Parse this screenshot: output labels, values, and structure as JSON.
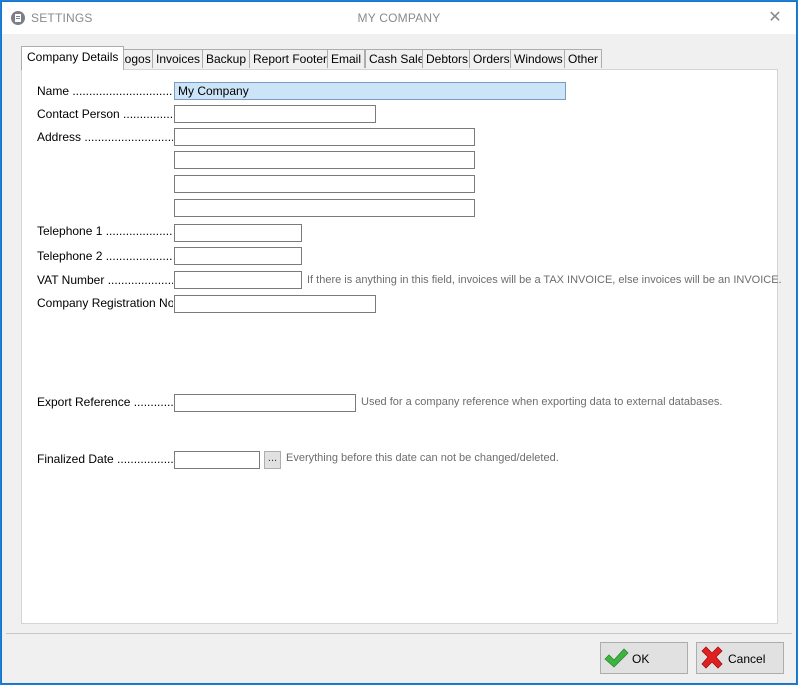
{
  "window": {
    "title_left": "SETTINGS",
    "title_center": "MY COMPANY",
    "close_glyph": "✕"
  },
  "tabs": [
    {
      "label": "Company Details",
      "active": true
    },
    {
      "label": "Logos"
    },
    {
      "label": "Invoices"
    },
    {
      "label": "Backup"
    },
    {
      "label": "Report Footers"
    },
    {
      "label": "Email"
    },
    {
      "label": "Cash Sale"
    },
    {
      "label": "Debtors"
    },
    {
      "label": "Orders"
    },
    {
      "label": "Windows"
    },
    {
      "label": "Other"
    }
  ],
  "form": {
    "name_label": "Name .......................................",
    "name_value": "My Company",
    "contact_label": "Contact Person ......................",
    "contact_value": "",
    "address_label": "Address ..................................",
    "address_lines": [
      "",
      "",
      "",
      ""
    ],
    "tel1_label": "Telephone 1 ...........................",
    "tel1_value": "",
    "tel2_label": "Telephone 2 ...........................",
    "tel2_value": "",
    "vat_label": "VAT Number ............................",
    "vat_value": "",
    "vat_hint": "If there is anything in this field, invoices will be a TAX INVOICE, else invoices will be an INVOICE.",
    "reg_label": "Company Registration No ......",
    "reg_value": "",
    "export_label": "Export Reference ..................",
    "export_value": "",
    "export_hint": "Used for a company reference when exporting data to external databases.",
    "finalized_label": "Finalized Date ......................",
    "finalized_value": "",
    "browse_label": "...",
    "finalized_hint": "Everything before this date can not be changed/deleted."
  },
  "buttons": {
    "ok_label": "OK",
    "cancel_label": "Cancel"
  },
  "colors": {
    "ok_icon": "#3fb33f",
    "cancel_icon": "#e02020",
    "selection": "#cce4f7"
  },
  "icons": {
    "ok": "checkmark-icon",
    "cancel": "cross-icon"
  }
}
